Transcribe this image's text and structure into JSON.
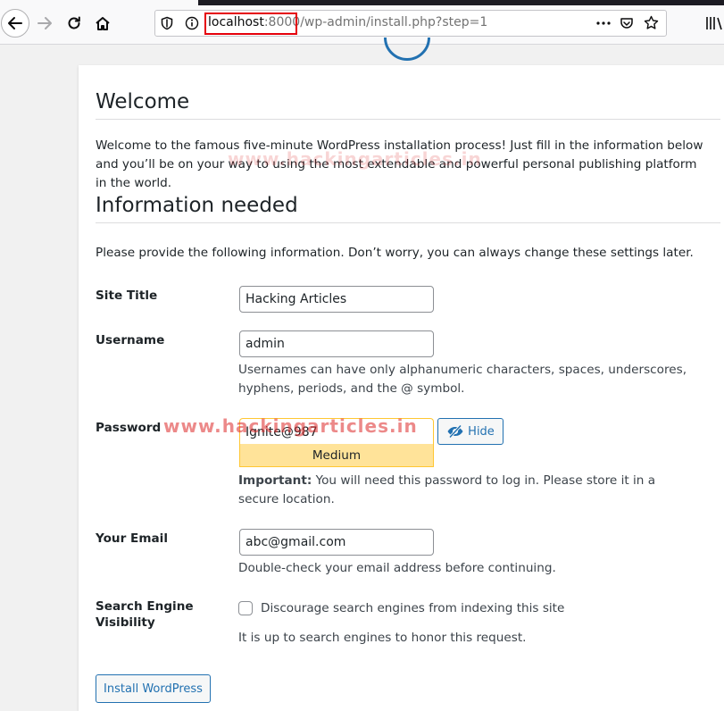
{
  "browser": {
    "url_host": "localhost",
    "url_port": ":8000",
    "url_path": "/wp-admin/install.php?step=1",
    "icons": [
      "back-icon",
      "forward-icon",
      "reload-icon",
      "home-icon",
      "shield-icon",
      "info-icon",
      "more-icon",
      "pocket-icon",
      "star-icon",
      "library-icon"
    ]
  },
  "page": {
    "welcome_heading": "Welcome",
    "welcome_text": "Welcome to the famous five-minute WordPress installation process! Just fill in the information below and you’ll be on your way to using the most extendable and powerful personal publishing platform in the world.",
    "info_heading": "Information needed",
    "provide_text": "Please provide the following information. Don’t worry, you can always change these settings later."
  },
  "form": {
    "site_title_label": "Site Title",
    "site_title_value": "Hacking Articles",
    "username_label": "Username",
    "username_value": "admin",
    "username_desc": "Usernames can have only alphanumeric characters, spaces, underscores, hyphens, periods, and the @ symbol.",
    "password_label": "Password",
    "password_value": "Ignite@987",
    "hide_button": "Hide",
    "strength": "Medium",
    "password_important": "Important:",
    "password_desc": " You will need this password to log in. Please store it in a secure location.",
    "email_label": "Your Email",
    "email_value": "abc@gmail.com",
    "email_desc": "Double-check your email address before continuing.",
    "seo_label": "Search Engine Visibility",
    "seo_checkbox_label": "Discourage search engines from indexing this site",
    "seo_checked": false,
    "seo_desc": "It is up to search engines to honor this request.",
    "install_button": "Install WordPress"
  },
  "watermark": {
    "text1": "www.hackingarticles.in",
    "text2": "www.hackingarticles.in"
  },
  "colors": {
    "accent": "#2271b1",
    "strength_bg": "#ffe399",
    "strength_border": "#ffc733",
    "highlight_box": "#e5000b"
  }
}
